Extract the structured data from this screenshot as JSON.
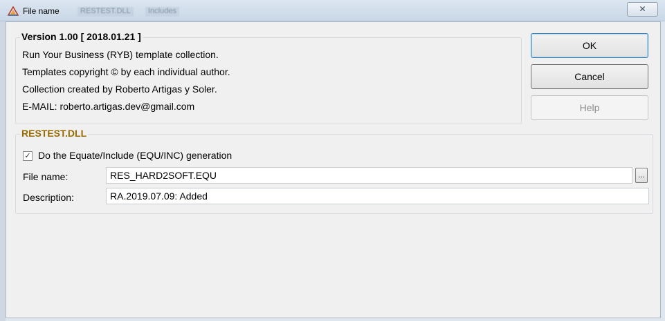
{
  "window": {
    "title": "File name",
    "background_titles": [
      "RESTEST.DLL",
      "Includes"
    ],
    "close_glyph": "✕"
  },
  "about": {
    "group_title": "Version 1.00 [ 2018.01.21 ]",
    "lines": [
      "Run Your Business (RYB) template collection.",
      "Templates copyright © by each individual author.",
      "Collection created by Roberto Artigas y Soler.",
      "E-MAIL: roberto.artigas.dev@gmail.com"
    ]
  },
  "buttons": {
    "ok": "OK",
    "cancel": "Cancel",
    "help": "Help"
  },
  "section": {
    "title": "RESTEST.DLL",
    "title_color": "#9a6a00",
    "checkbox_label": "Do the Equate/Include (EQU/INC) generation",
    "checkbox_checked": true,
    "checkbox_glyph": "✓",
    "file_name_label": "File name:",
    "file_name_value": "RES_HARD2SOFT.EQU",
    "browse_label": "...",
    "description_label": "Description:",
    "description_value": "RA.2019.07.09: Added"
  },
  "icons": {
    "app": "triangle-logo-icon",
    "close": "close-icon"
  }
}
